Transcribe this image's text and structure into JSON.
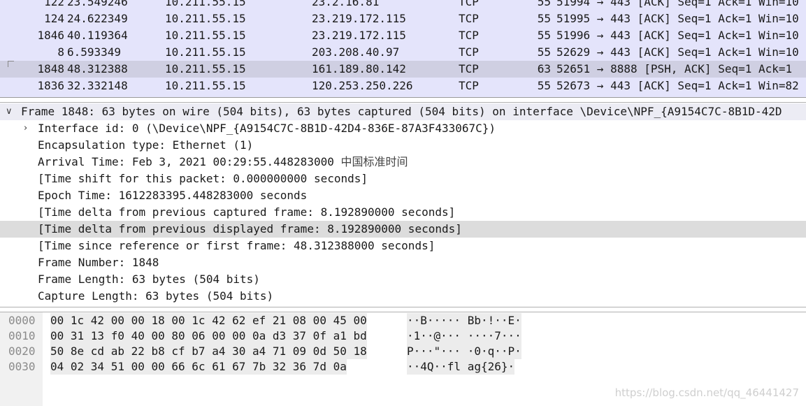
{
  "packets": [
    {
      "no": "122",
      "time": "23.549246",
      "src": "10.211.55.15",
      "dst": "23.2.16.81",
      "proto": "TCP",
      "len": "55",
      "info": "51994 → 443 [ACK] Seq=1 Ack=1 Win=10"
    },
    {
      "no": "124",
      "time": "24.622349",
      "src": "10.211.55.15",
      "dst": "23.219.172.115",
      "proto": "TCP",
      "len": "55",
      "info": "51995 → 443 [ACK] Seq=1 Ack=1 Win=10"
    },
    {
      "no": "1846",
      "time": "40.119364",
      "src": "10.211.55.15",
      "dst": "23.219.172.115",
      "proto": "TCP",
      "len": "55",
      "info": "51996 → 443 [ACK] Seq=1 Ack=1 Win=10"
    },
    {
      "no": "8",
      "time": "6.593349",
      "src": "10.211.55.15",
      "dst": "203.208.40.97",
      "proto": "TCP",
      "len": "55",
      "info": "52629 → 443 [ACK] Seq=1 Ack=1 Win=10"
    },
    {
      "no": "1848",
      "time": "48.312388",
      "src": "10.211.55.15",
      "dst": "161.189.80.142",
      "proto": "TCP",
      "len": "63",
      "info": "52651 → 8888 [PSH, ACK] Seq=1 Ack=1"
    },
    {
      "no": "1836",
      "time": "32.332148",
      "src": "10.211.55.15",
      "dst": "120.253.250.226",
      "proto": "TCP",
      "len": "55",
      "info": "52673 → 443 [ACK] Seq=1 Ack=1 Win=82"
    }
  ],
  "details": {
    "frame": "Frame 1848: 63 bytes on wire (504 bits), 63 bytes captured (504 bits) on interface \\Device\\NPF_{A9154C7C-8B1D-42D",
    "interface": "Interface id: 0 (\\Device\\NPF_{A9154C7C-8B1D-42D4-836E-87A3F433067C})",
    "encapsulation": "Encapsulation type: Ethernet (1)",
    "arrival": "Arrival Time: Feb  3, 2021 00:29:55.448283000",
    "arrival_tz": "中国标准时间",
    "time_shift": "[Time shift for this packet: 0.000000000 seconds]",
    "epoch": "Epoch Time: 1612283395.448283000 seconds",
    "delta_captured": "[Time delta from previous captured frame: 8.192890000 seconds]",
    "delta_displayed": "[Time delta from previous displayed frame: 8.192890000 seconds]",
    "since_reference": "[Time since reference or first frame: 48.312388000 seconds]",
    "frame_number": "Frame Number: 1848",
    "frame_length": "Frame Length: 63 bytes (504 bits)",
    "capture_length": "Capture Length: 63 bytes (504 bits)"
  },
  "bytes": [
    {
      "offset": "0000",
      "hex": "00 1c 42 00 00 18 00 1c  42 62 ef 21 08 00 45 00",
      "ascii": "··B·····  Bb·!··E·"
    },
    {
      "offset": "0010",
      "hex": "00 31 13 f0 40 00 80 06  00 00 0a d3 37 0f a1 bd",
      "ascii": "·1··@···  ····7···"
    },
    {
      "offset": "0020",
      "hex": "50 8e cd ab 22 b8 cf b7  a4 30 a4 71 09 0d 50 18",
      "ascii": "P···\"···  ·0·q··P·"
    },
    {
      "offset": "0030",
      "hex": "04 02 34 51 00 00 66 6c  61 67 7b 32 36 7d 0a",
      "ascii": "··4Q··fl  ag{26}·"
    }
  ],
  "watermark": "https://blog.csdn.net/qq_46441427"
}
